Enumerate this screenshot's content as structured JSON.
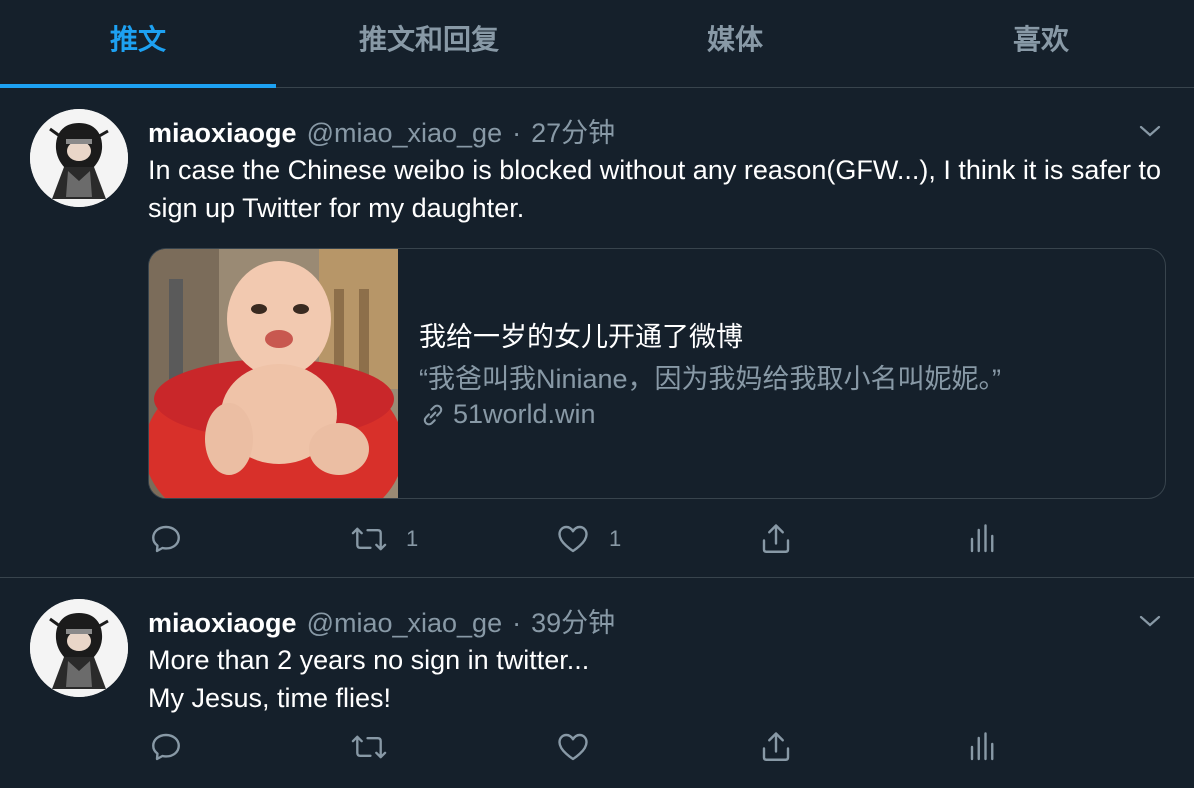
{
  "tabs": [
    {
      "label": "推文",
      "active": true
    },
    {
      "label": "推文和回复",
      "active": false
    },
    {
      "label": "媒体",
      "active": false
    },
    {
      "label": "喜欢",
      "active": false
    }
  ],
  "tweets": [
    {
      "name": "miaoxiaoge",
      "handle": "@miao_xiao_ge",
      "separator": "·",
      "time": "27分钟",
      "text": "In case the Chinese weibo is blocked without any reason(GFW...), I think it is safer to sign up Twitter for my daughter.",
      "card": {
        "title": "我给一岁的女儿开通了微博",
        "description": "“我爸叫我Niniane，因为我妈给我取小名叫妮妮。”",
        "link": "51world.win"
      },
      "actions": {
        "replies": "",
        "retweets": "1",
        "likes": "1"
      }
    },
    {
      "name": "miaoxiaoge",
      "handle": "@miao_xiao_ge",
      "separator": "·",
      "time": "39分钟",
      "text_line1": "More than 2 years no sign in twitter...",
      "text_line2": "My Jesus, time flies!",
      "actions": {
        "replies": "",
        "retweets": "",
        "likes": ""
      }
    }
  ],
  "colors": {
    "background": "#15202b",
    "accent": "#1da1f2",
    "muted": "#8899a6",
    "border": "#38444d"
  },
  "icons": [
    "chevron-down-icon",
    "reply-icon",
    "retweet-icon",
    "like-icon",
    "share-icon",
    "analytics-icon",
    "link-icon"
  ]
}
